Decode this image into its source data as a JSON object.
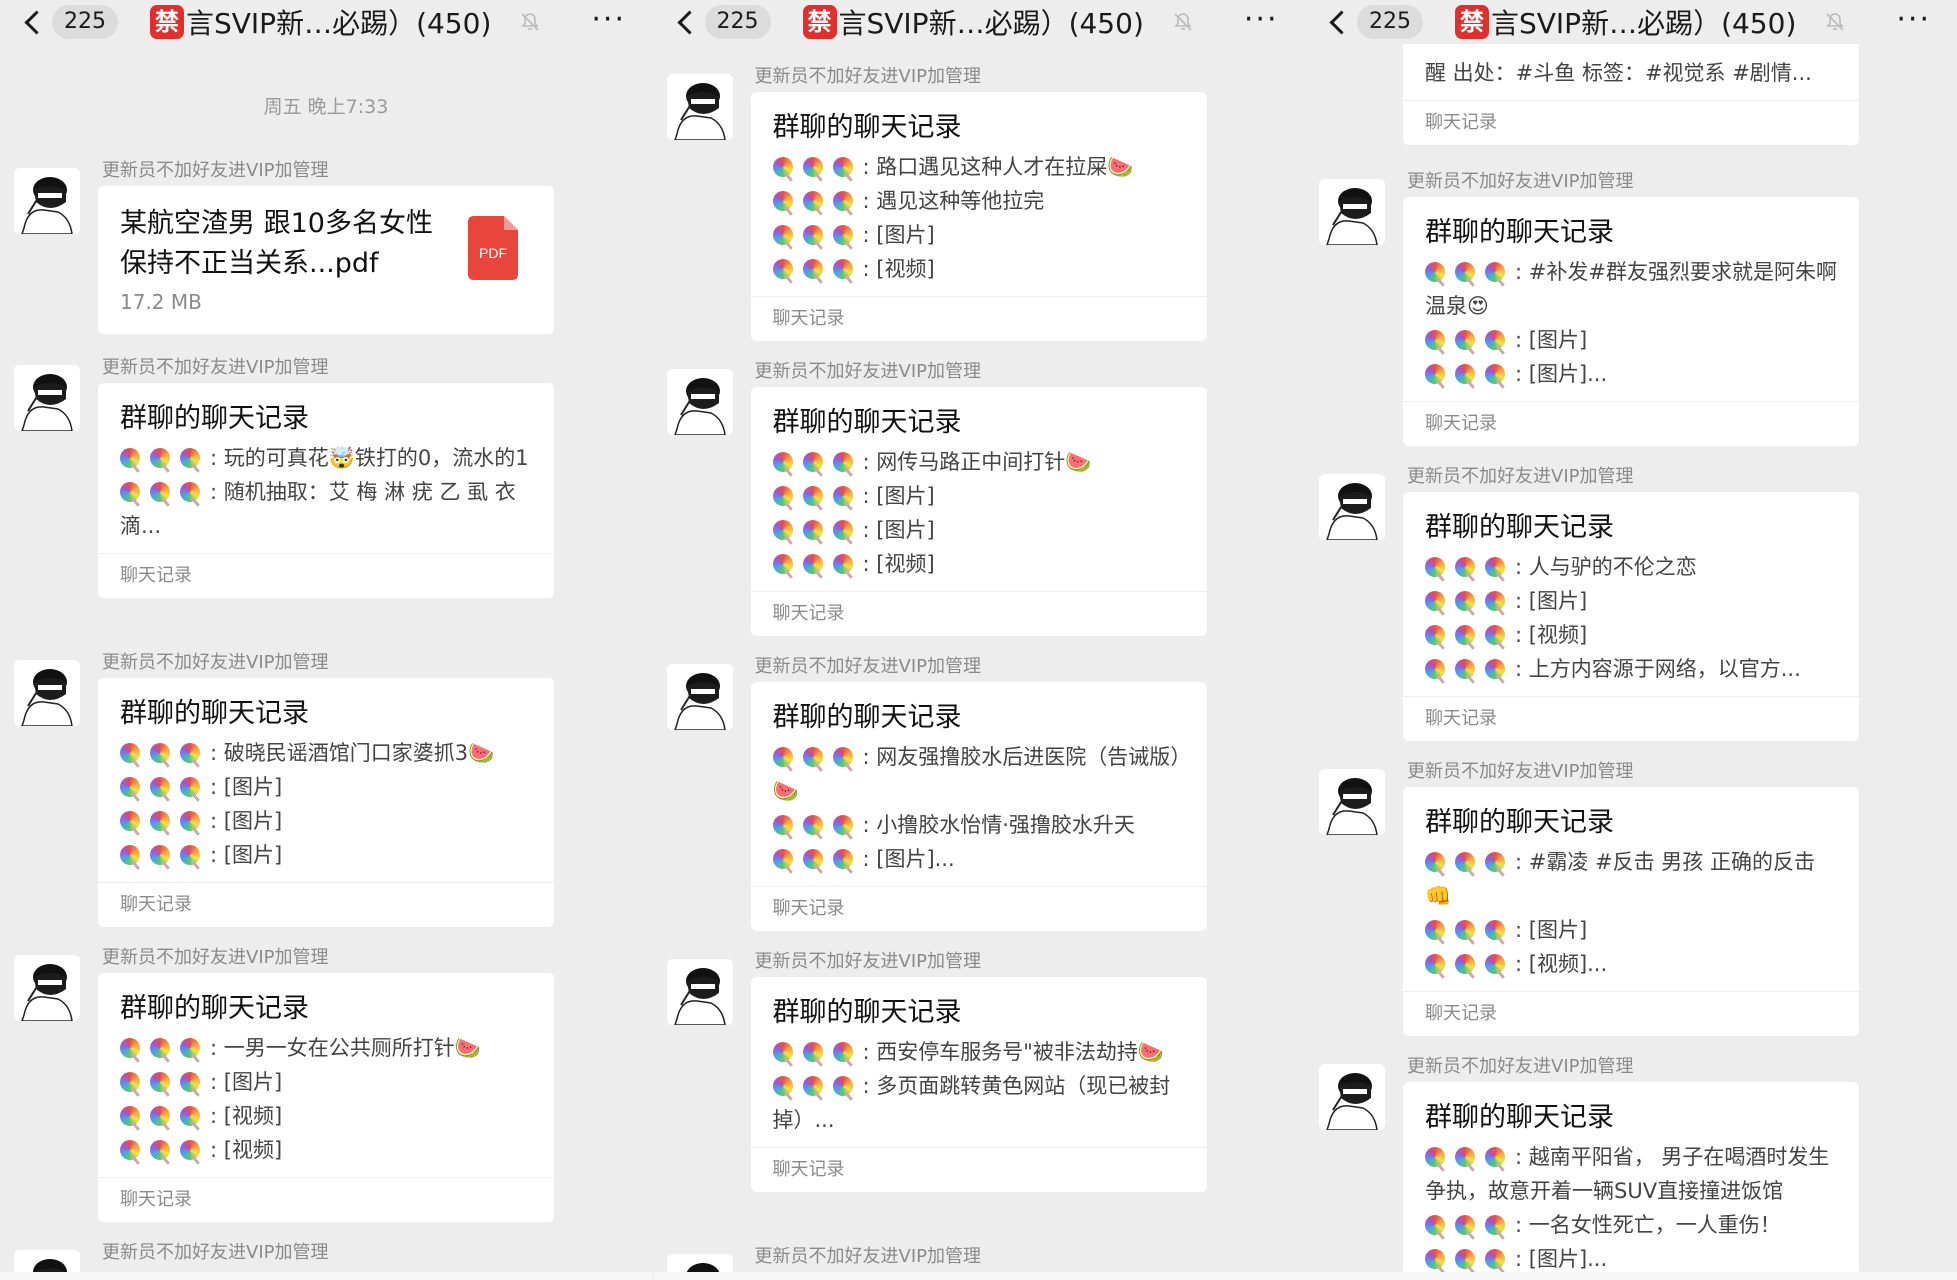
{
  "colors": {
    "ban_tag": "#e0302d",
    "pdf": "#e8453c",
    "background": "#ededed"
  },
  "panels": [
    {
      "nav": {
        "unread": "225",
        "ban_char": "禁",
        "title": "言SVIP新…必踢）(450)"
      },
      "timestamp": "周五 晚上7:33",
      "msgs": [
        {
          "sender": "更新员不加好友进VIP加管理",
          "file_name": "某航空渣男 跟10多名女性保持不正当关系...pdf",
          "file_size": "17.2 MB",
          "file_icon": "PDF"
        },
        {
          "sender": "更新员不加好友进VIP加管理",
          "title": "群聊的聊天记录",
          "lines": [
            ": 玩的可真花🤯铁打的0，流水的1",
            ": 随机抽取：艾 梅 淋 疣 乙 虱 衣 滴..."
          ],
          "footer": "聊天记录"
        },
        {
          "sender": "更新员不加好友进VIP加管理",
          "title": "群聊的聊天记录",
          "lines": [
            ": 破晓民谣酒馆门口家婆抓3🍉",
            ": [图片]",
            ": [图片]",
            ": [图片]"
          ],
          "footer": "聊天记录"
        },
        {
          "sender": "更新员不加好友进VIP加管理",
          "title": "群聊的聊天记录",
          "lines": [
            ": 一男一女在公共厕所打针🍉",
            ": [图片]",
            ": [视频]",
            ": [视频]"
          ],
          "footer": "聊天记录"
        },
        {
          "sender": "更新员不加好友进VIP加管理"
        }
      ]
    },
    {
      "nav": {
        "unread": "225",
        "ban_char": "禁",
        "title": "言SVIP新…必踢）(450)"
      },
      "msgs": [
        {
          "sender": "更新员不加好友进VIP加管理",
          "title": "群聊的聊天记录",
          "lines": [
            ": 路口遇见这种人才在拉屎🍉",
            ": 遇见这种等他拉完",
            ": [图片]",
            ": [视频]"
          ],
          "footer": "聊天记录"
        },
        {
          "sender": "更新员不加好友进VIP加管理",
          "title": "群聊的聊天记录",
          "lines": [
            ": 网传马路正中间打针🍉",
            ": [图片]",
            ": [图片]",
            ": [视频]"
          ],
          "footer": "聊天记录"
        },
        {
          "sender": "更新员不加好友进VIP加管理",
          "title": "群聊的聊天记录",
          "lines": [
            ": 网友强撸胶水后进医院（告诫版）🍉",
            ": 小撸胶水怡情·强撸胶水升天",
            ": [图片]..."
          ],
          "footer": "聊天记录"
        },
        {
          "sender": "更新员不加好友进VIP加管理",
          "title": "群聊的聊天记录",
          "lines": [
            ": 西安停车服务号\"被非法劫持🍉",
            ": 多页面跳转黄色网站（现已被封掉）..."
          ],
          "footer": "聊天记录"
        },
        {
          "sender": "更新员不加好友进VIP加管理"
        }
      ]
    },
    {
      "nav": {
        "unread": "225",
        "ban_char": "禁",
        "title": "言SVIP新…必踢）(450)"
      },
      "top_partial": {
        "text": "醒 出处：#斗鱼 标签：#视觉系 #剧情...",
        "footer": "聊天记录"
      },
      "msgs": [
        {
          "sender": "更新员不加好友进VIP加管理",
          "title": "群聊的聊天记录",
          "lines": [
            ": #补发#群友强烈要求就是阿朱啊 温泉😍",
            ": [图片]",
            ": [图片]..."
          ],
          "footer": "聊天记录"
        },
        {
          "sender": "更新员不加好友进VIP加管理",
          "title": "群聊的聊天记录",
          "lines": [
            ": 人与驴的不伦之恋",
            ": [图片]",
            ": [视频]",
            ": 上方内容源于网络，以官方..."
          ],
          "footer": "聊天记录"
        },
        {
          "sender": "更新员不加好友进VIP加管理",
          "title": "群聊的聊天记录",
          "lines": [
            ": #霸凌 #反击 男孩 正确的反击👊",
            ": [图片]",
            ": [视频]..."
          ],
          "footer": "聊天记录"
        },
        {
          "sender": "更新员不加好友进VIP加管理",
          "title": "群聊的聊天记录",
          "lines": [
            ": 越南平阳省， 男子在喝酒时发生争执，故意开着一辆SUV直接撞进饭馆",
            ": 一名女性死亡，一人重伤！",
            ": [图片]..."
          ]
        }
      ]
    }
  ]
}
